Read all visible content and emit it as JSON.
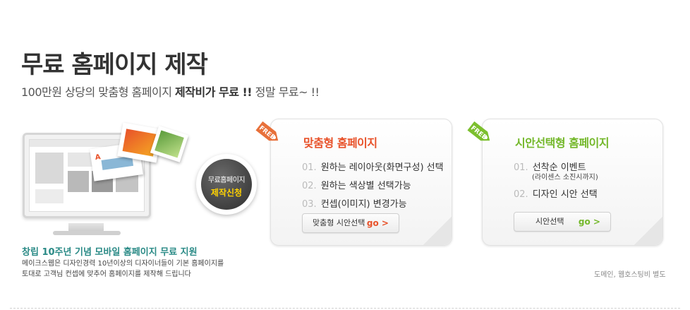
{
  "header": {
    "title": "무료 홈페이지 제작",
    "subtitle_prefix": "100만원 상당의 맞춤형 홈페이지 ",
    "subtitle_bold": "제작비가 무료 !!",
    "subtitle_suffix": "  정말 무료~ !!"
  },
  "promo": {
    "bubble_line1": "무료홈페이지",
    "bubble_line2": "제작신청",
    "anniversary": "창립 10주년 기념 모바일 홈페이지 무료 지원",
    "desc_line1": "메이크스웹은 디자인경력 10년이상의 디자이너들이 기본 홈페이지를",
    "desc_line2": "토대로 고객님 컨셉에 맞추어 홈페이지를 제작해 드립니다"
  },
  "panel1": {
    "tag": "FREE",
    "title": "맞춤형 홈페이지",
    "items": [
      {
        "num": "01.",
        "text": "원하는 레이아웃(화면구성) 선택"
      },
      {
        "num": "02.",
        "text": "원하는 색상별 선택가능"
      },
      {
        "num": "03.",
        "text": "컨셉(이미지) 변경가능"
      }
    ],
    "button_label": "맞춤형 시안선택",
    "button_go": "go >"
  },
  "panel2": {
    "tag": "FREE",
    "title": "시안선택형 홈페이지",
    "items": [
      {
        "num": "01.",
        "text": "선착순 이벤트",
        "sub": "(라이센스 소진시까지)"
      },
      {
        "num": "02.",
        "text": "디자인 시안 선택"
      }
    ],
    "button_label": "시안선택",
    "button_go": "go >"
  },
  "footer_note": "도메인, 웹호스팅비 별도",
  "colors": {
    "accent_orange": "#e8522a",
    "accent_green": "#74b82b",
    "teal_text": "#2a8a86",
    "bubble_highlight": "#ffd200"
  }
}
